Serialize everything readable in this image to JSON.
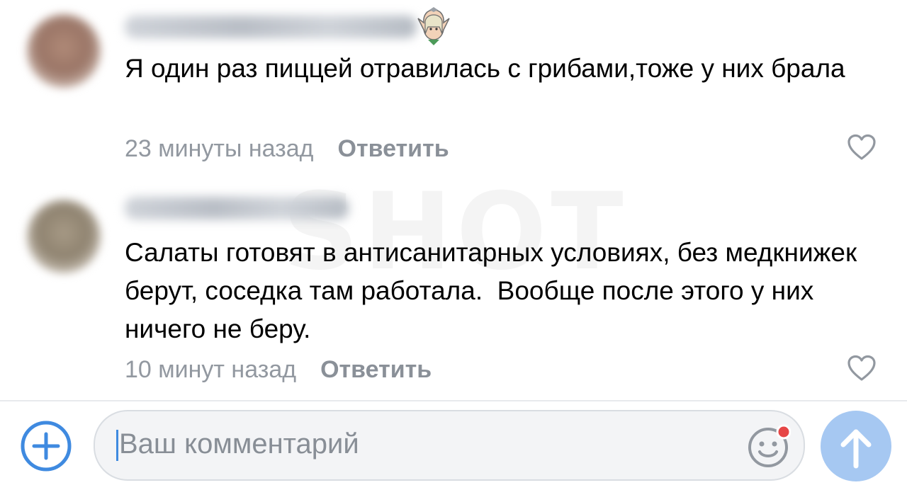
{
  "comments": [
    {
      "text": "Я один раз пиццей отравилась с грибами,тоже у них брала",
      "time": "23 минуты назад",
      "reply_label": "Ответить",
      "badge_icon": "elf-icon"
    },
    {
      "text": "Салаты готовят в антисанитарных условиях, без медкнижек берут, соседка там работала.  Вообще после этого у них ничего не беру.",
      "time": "10 минут назад",
      "reply_label": "Ответить"
    }
  ],
  "watermark": "SHOT",
  "composer": {
    "placeholder": "Ваш комментарий",
    "add_icon": "plus-circle-icon",
    "emoji_icon": "smiley-icon",
    "send_icon": "arrow-up-icon"
  },
  "colors": {
    "accent": "#3f8ae0",
    "send_button": "#a6c8f2",
    "secondary_text": "#9298a0",
    "notification_dot": "#e64646"
  }
}
